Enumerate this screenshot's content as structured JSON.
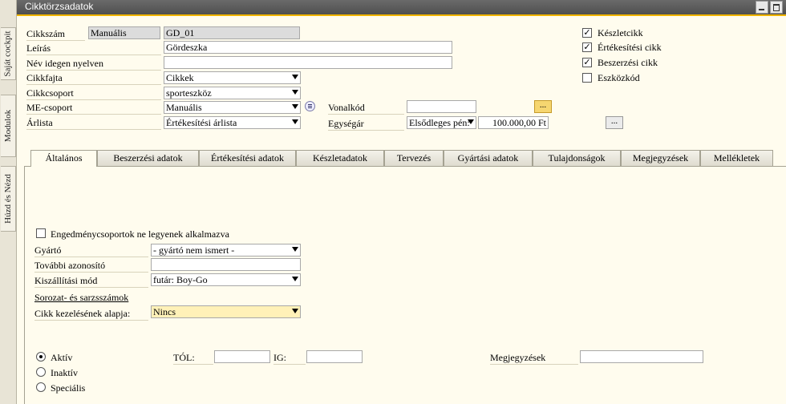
{
  "window": {
    "title": "Cikktörzsadatok"
  },
  "side_tabs": [
    "Saját cockpit",
    "Modulok",
    "Húzd és Nézd"
  ],
  "header": {
    "item_code_label": "Cikkszám",
    "item_code_series": "Manuális",
    "item_code_value": "GD_01",
    "description_label": "Leírás",
    "description_value": "Gördeszka",
    "foreign_name_label": "Név idegen nyelven",
    "foreign_name_value": "",
    "item_type_label": "Cikkfajta",
    "item_type_value": "Cikkek",
    "item_group_label": "Cikkcsoport",
    "item_group_value": "sporteszköz",
    "uom_group_label": "ME-csoport",
    "uom_group_value": "Manuális",
    "price_list_label": "Árlista",
    "price_list_value": "Értékesítési árlista",
    "barcode_label": "Vonalkód",
    "barcode_value": "",
    "barcode_button": "...",
    "unit_price_label": "Egységár",
    "unit_price_currency": "Elsődleges pén:",
    "unit_price_value": "100.000,00 Ft",
    "unit_price_button": "..."
  },
  "checkboxes": [
    {
      "label": "Készletcikk",
      "checked": true,
      "mark": "✓"
    },
    {
      "label": "Értékesítési cikk",
      "checked": true,
      "mark": "✓"
    },
    {
      "label": "Beszerzési cikk",
      "checked": true,
      "mark": "✓"
    },
    {
      "label": "Eszközkód",
      "checked": false,
      "mark": ""
    }
  ],
  "tabs": [
    "Általános",
    "Beszerzési adatok",
    "Értékesítési adatok",
    "Készletadatok",
    "Tervezés",
    "Gyártási adatok",
    "Tulajdonságok",
    "Megjegyzések",
    "Mellékletek"
  ],
  "general": {
    "no_discount_label": "Engedménycsoportok ne legyenek alkalmazva",
    "manufacturer_label": "Gyártó",
    "manufacturer_value": "- gyártó nem ismert -",
    "additional_id_label": "További azonosító",
    "additional_id_value": "",
    "shipping_label": "Kiszállítási mód",
    "shipping_value": "futár: Boy-Go",
    "serial_batch_label": "Sorozat- és sarzsszámok",
    "manage_by_label": "Cikk kezelésének alapja:",
    "manage_by_value": "Nincs",
    "status_options": [
      "Aktív",
      "Inaktív",
      "Speciális"
    ],
    "from_label": "TÓL:",
    "from_value": "",
    "to_label": "IG:",
    "to_value": "",
    "remarks_label": "Megjegyzések",
    "remarks_value": ""
  }
}
